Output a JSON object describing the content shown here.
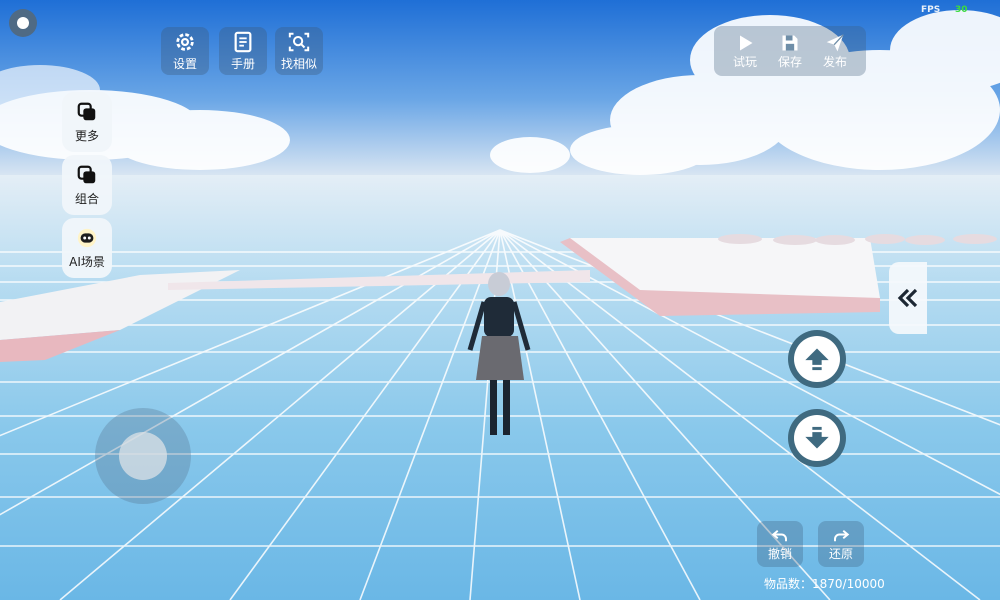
{
  "hud": {
    "fps_label": "FPS",
    "fps_value": "30",
    "item_count": "物品数：1870/10000"
  },
  "top_left_toolbar": [
    {
      "label": "设置",
      "icon": "gear-icon"
    },
    {
      "label": "手册",
      "icon": "manual-icon"
    },
    {
      "label": "找相似",
      "icon": "find-similar-icon"
    }
  ],
  "top_right_toolbar": [
    {
      "label": "试玩",
      "icon": "play-icon"
    },
    {
      "label": "保存",
      "icon": "save-icon"
    },
    {
      "label": "发布",
      "icon": "publish-icon"
    }
  ],
  "left_menu": [
    {
      "label": "更多",
      "icon": "copy-icon"
    },
    {
      "label": "组合",
      "icon": "combine-icon"
    },
    {
      "label": "AI场景",
      "icon": "ai-robot-icon"
    }
  ],
  "bottom_right": {
    "undo_label": "撤销",
    "redo_label": "还原"
  },
  "colors": {
    "accent_dark": "#3f6a80",
    "fps_green": "#3ddc3d",
    "grid_floor": "#7fc0e6"
  }
}
